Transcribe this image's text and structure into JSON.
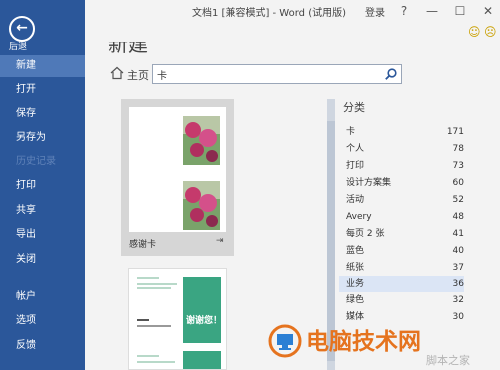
{
  "window": {
    "title": "文档1 [兼容模式] - Word (试用版)",
    "login": "登录",
    "help": "?",
    "minimize": "—",
    "restore": "☐",
    "close": "✕",
    "smiley_happy": "☺",
    "smiley_sad": "☹"
  },
  "sidebar": {
    "back_icon": "←",
    "back_label": "后退",
    "items": [
      {
        "label": "新建"
      },
      {
        "label": "打开"
      },
      {
        "label": "保存"
      },
      {
        "label": "另存为"
      },
      {
        "label": "历史记录"
      },
      {
        "label": "打印"
      },
      {
        "label": "共享"
      },
      {
        "label": "导出"
      },
      {
        "label": "关闭"
      },
      {
        "label": "帐户"
      },
      {
        "label": "选项"
      },
      {
        "label": "反馈"
      }
    ]
  },
  "main": {
    "heading": "新建",
    "home_label": "主页",
    "search_value": "卡",
    "templates": [
      {
        "label": "感谢卡",
        "pin_icon": "⇥"
      },
      {
        "thank_text": "谢谢您！"
      }
    ]
  },
  "categories": {
    "title": "分类",
    "items": [
      {
        "name": "卡",
        "count": "171"
      },
      {
        "name": "个人",
        "count": "78"
      },
      {
        "name": "打印",
        "count": "73"
      },
      {
        "name": "设计方案集",
        "count": "60"
      },
      {
        "name": "活动",
        "count": "52"
      },
      {
        "name": "Avery",
        "count": "48"
      },
      {
        "name": "每页 2 张",
        "count": "41"
      },
      {
        "name": "蓝色",
        "count": "40"
      },
      {
        "name": "纸张",
        "count": "37"
      },
      {
        "name": "业务",
        "count": "36"
      },
      {
        "name": "绿色",
        "count": "32"
      },
      {
        "name": "媒体",
        "count": "30"
      }
    ]
  },
  "watermark": {
    "text": "电脑技术网",
    "sub": "脚本之家"
  },
  "colors": {
    "sidebar": "#2b579a",
    "accent_orange": "#e5731e"
  }
}
